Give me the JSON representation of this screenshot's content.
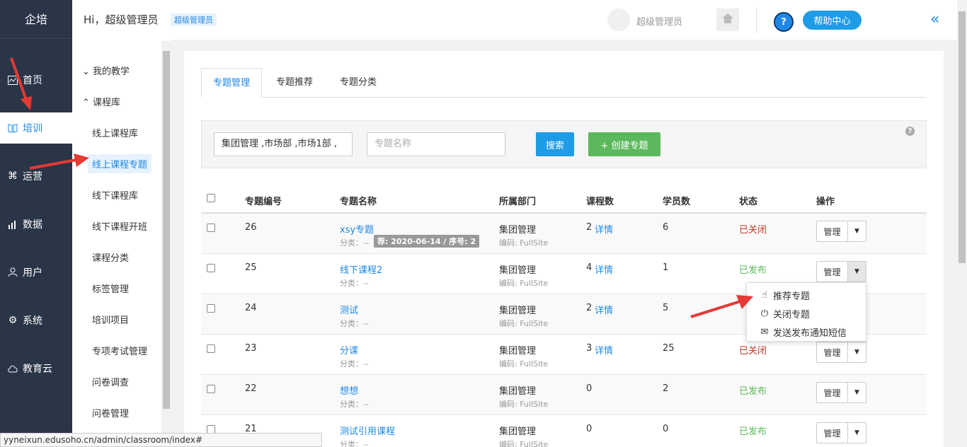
{
  "sidebar": {
    "logo": "企培",
    "items": [
      {
        "label": "首页",
        "icon": "chart-icon"
      },
      {
        "label": "培训",
        "icon": "book-icon"
      },
      {
        "label": "运营",
        "icon": "command-icon"
      },
      {
        "label": "数据",
        "icon": "bar-chart-icon"
      },
      {
        "label": "用户",
        "icon": "user-icon"
      },
      {
        "label": "系统",
        "icon": "gear-icon"
      },
      {
        "label": "教育云",
        "icon": "cloud-icon"
      }
    ],
    "active": "培训"
  },
  "header": {
    "greeting": "Hi，超级管理员",
    "role_badge": "超级管理员",
    "user_name": "超级管理员",
    "help_button": "帮助中心",
    "help_icon": "?"
  },
  "subnav": {
    "items": [
      {
        "label": "我的教学",
        "type": "group",
        "chevron": "collapsed"
      },
      {
        "label": "课程库",
        "type": "group",
        "chevron": "expanded"
      },
      {
        "label": "线上课程库"
      },
      {
        "label": "线上课程专题",
        "active": true
      },
      {
        "label": "线下课程库"
      },
      {
        "label": "线下课程开班"
      },
      {
        "label": "课程分类"
      },
      {
        "label": "标签管理"
      },
      {
        "label": "培训项目"
      },
      {
        "label": "专项考试管理"
      },
      {
        "label": "问卷调查"
      },
      {
        "label": "问卷管理"
      }
    ]
  },
  "tabs": [
    "专题管理",
    "专题推荐",
    "专题分类"
  ],
  "filter": {
    "department_value": "集团管理 ,市场部 ,市场1部 ,",
    "name_placeholder": "专题名称",
    "search_button": "搜索",
    "create_button": "+ 创建专题"
  },
  "table": {
    "headers": [
      "专题编号",
      "专题名称",
      "所属部门",
      "课程数",
      "学员数",
      "状态",
      "操作"
    ],
    "rows": [
      {
        "id": "26",
        "name": "xsy专题",
        "category": "分类：--",
        "tag": "荐: 2020-06-14 / 序号: 2",
        "dept": "集团管理",
        "code": "编码: FullSite",
        "courses": "2",
        "details": "详情",
        "students": "6",
        "status": "已关闭",
        "status_type": "closed",
        "action": "管理"
      },
      {
        "id": "25",
        "name": "线下课程2",
        "category": "分类：--",
        "tag": "",
        "dept": "集团管理",
        "code": "编码: FullSite",
        "courses": "4",
        "details": "详情",
        "students": "1",
        "status": "已发布",
        "status_type": "published",
        "action": "管理"
      },
      {
        "id": "24",
        "name": "测试",
        "category": "分类：--",
        "tag": "",
        "dept": "集团管理",
        "code": "编码: FullSite",
        "courses": "2",
        "details": "详情",
        "students": "5",
        "status": "",
        "status_type": "hidden",
        "action": ""
      },
      {
        "id": "23",
        "name": "分课",
        "category": "分类：--",
        "tag": "",
        "dept": "集团管理",
        "code": "编码: FullSite",
        "courses": "3",
        "details": "详情",
        "students": "25",
        "status": "已关闭",
        "status_type": "closed",
        "action": "管理"
      },
      {
        "id": "22",
        "name": "想想",
        "category": "分类：--",
        "tag": "",
        "dept": "集团管理",
        "code": "编码: FullSite",
        "courses": "0",
        "details": "",
        "students": "2",
        "status": "已发布",
        "status_type": "published",
        "action": "管理"
      },
      {
        "id": "21",
        "name": "测试引用课程",
        "category": "分类：--",
        "tag": "",
        "dept": "集团管理",
        "code": "编码: FullSite",
        "courses": "0",
        "details": "",
        "students": "0",
        "status": "已发布",
        "status_type": "published",
        "action": "管理"
      }
    ]
  },
  "dropdown_menu": [
    {
      "label": "推荐专题",
      "icon": "pointer-hand-icon"
    },
    {
      "label": "关闭专题",
      "icon": "power-icon"
    },
    {
      "label": "发送发布通知短信",
      "icon": "envelope-icon"
    }
  ],
  "status_url": "yyneixun.edusoho.cn/admin/classroom/index#",
  "colors": {
    "sidebar_bg": "#2a3548",
    "accent": "#1e88e5",
    "success": "#5cb85c",
    "danger": "#c0392b",
    "annotation_arrow": "#e53935"
  }
}
